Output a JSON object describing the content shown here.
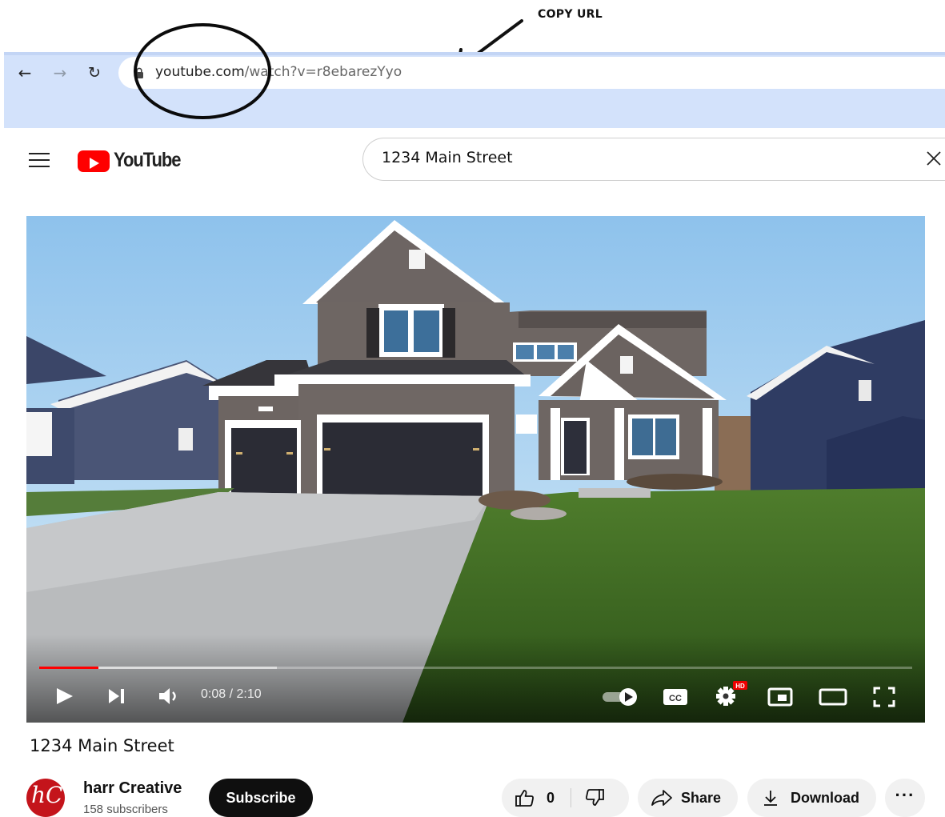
{
  "annotation": {
    "label": "COPY URL"
  },
  "browser": {
    "url_domain": "youtube.com",
    "url_path": "/watch?v=r8ebarezYyo",
    "icons": [
      "back-arrow-icon",
      "forward-arrow-icon",
      "reload-icon",
      "lock-icon"
    ]
  },
  "header": {
    "logo_text": "YouTube",
    "search_value": "1234 Main Street"
  },
  "player": {
    "current_time": "0:08",
    "duration": "2:10",
    "time_display": "0:08 / 2:10",
    "progress_played_fraction": 0.068,
    "progress_buffered_fraction": 0.272,
    "settings_badge": "HD",
    "cc_label": "CC"
  },
  "video": {
    "title": "1234 Main Street",
    "channel_name": "harr Creative",
    "channel_avatar_text": "hC",
    "subscribers": "158 subscribers",
    "subscribe_label": "Subscribe",
    "like_count": "0",
    "share_label": "Share",
    "download_label": "Download",
    "more_label": "···"
  },
  "colors": {
    "brand_red": "#ff0000",
    "browser_toolbar": "#d3e2fb",
    "pill_bg": "#f1f1f1",
    "subscribe_bg": "#0f0f0f"
  }
}
